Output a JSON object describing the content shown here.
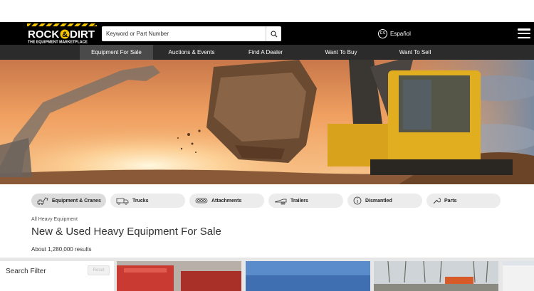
{
  "header": {
    "logo_line1": "ROCK & DIRT",
    "logo_tagline": "THE EQUIPMENT MARKETPLACE",
    "search_placeholder": "Keyword or Part Number",
    "language_badge": "ES",
    "language_label": "Español"
  },
  "nav": {
    "items": [
      {
        "label": "Equipment For Sale",
        "active": true
      },
      {
        "label": "Auctions & Events",
        "active": false
      },
      {
        "label": "Find A Dealer",
        "active": false
      },
      {
        "label": "Want To Buy",
        "active": false
      },
      {
        "label": "Want To Sell",
        "active": false
      }
    ]
  },
  "categories": [
    {
      "label": "Equipment & Cranes",
      "icon": "excavator-icon"
    },
    {
      "label": "Trucks",
      "icon": "truck-icon"
    },
    {
      "label": "Attachments",
      "icon": "attachment-icon"
    },
    {
      "label": "Trailers",
      "icon": "trailer-icon"
    },
    {
      "label": "Dismantled",
      "icon": "info-icon"
    },
    {
      "label": "Parts",
      "icon": "wrench-icon"
    }
  ],
  "breadcrumb": "All Heavy Equipment",
  "page_title": "New & Used Heavy Equipment For Sale",
  "results_count": "About 1,280,000 results",
  "filter": {
    "label": "Search Filter",
    "reset_label": "Reset"
  },
  "colors": {
    "header_bg": "#000000",
    "nav_bg": "#2b2b2b",
    "nav_active": "#4a4a4a",
    "brand_yellow": "#f5c400",
    "pill_bg": "#ececec"
  }
}
